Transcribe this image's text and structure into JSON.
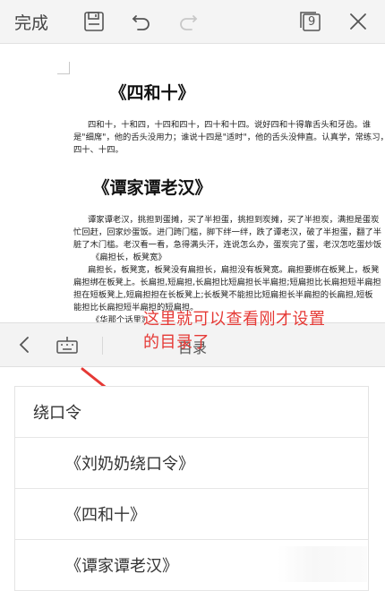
{
  "toolbar": {
    "done_label": "完成",
    "page_count": "9",
    "icons": [
      "save-icon",
      "undo-icon",
      "redo-icon",
      "page-count-icon",
      "close-icon"
    ]
  },
  "document": {
    "title1": "《四和十》",
    "para1": [
      "四和十，十和四，十四和四十，四十和十四。说好四和十得靠舌头和牙齿。谁",
      "是\"细席\"，他的舌头没用力；谁说十四是\"适时\"，他的舌头没伸直。认真学，常练习，",
      "四十、十四。"
    ],
    "title2": "《谭家谭老汉》",
    "para2": [
      "谭家谭老汉，挑担到蛋摊，买了半担蛋，挑担到炭摊，买了半担炭，满担是蛋炭",
      "忙回赶，回家炒蛋饭。进门跨门槛，脚下绊一绊，跌了谭老汉，破了半担蛋，翻了半",
      "脏了木门槛。老汉看一看，急得满头汗，连说怎么办，蛋炭完了蛋，老汉怎吃蛋炒饭",
      "《扁担长，板凳宽》",
      "扁担长，板凳宽，板凳没有扁担长，扁担没有板凳宽。扁担要绑在板凳上，板凳",
      "扁担绑在板凳上。长扁担,短扁担,长扁担比短扁担长半扁担;短扁担比长扁担短半扁担",
      "担在短板凳上,短扁担担在长板凳上;长板凳不能担比短扁担长半扁担的长扁担,短板",
      "能担比长扁担短半扁担的短扁担。",
      "《华那个话里》"
    ]
  },
  "annotation": {
    "line1": "这里就可以查看刚才设置",
    "line2": "的目录了"
  },
  "bottom_bar": {
    "title": "目录",
    "icons": [
      "back-arrow-icon",
      "keyboard-icon"
    ]
  },
  "toc": {
    "items": [
      {
        "label": "绕口令",
        "level": 1
      },
      {
        "label": "《刘奶奶绕口令》",
        "level": 2
      },
      {
        "label": "《四和十》",
        "level": 2
      },
      {
        "label": "《谭家谭老汉》",
        "level": 2
      }
    ]
  },
  "colors": {
    "annotation": "#e53935",
    "toolbar_bg": "#f4f4f4",
    "text": "#333333"
  }
}
